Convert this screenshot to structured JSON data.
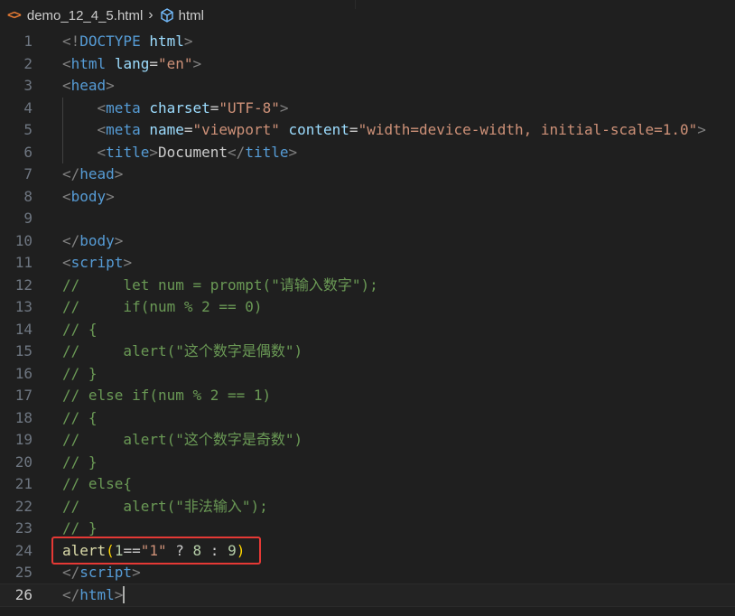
{
  "breadcrumb": {
    "file_icon": "<>",
    "file_name": "demo_12_4_5.html",
    "separator": "›",
    "element_name": "html"
  },
  "colors": {
    "background": "#1f1f1f",
    "tag": "#569cd6",
    "bracket": "#808080",
    "attribute": "#9cdcfe",
    "string": "#ce9178",
    "comment": "#6a9955",
    "function": "#dcdcaa",
    "number": "#b5cea8",
    "highlight_box": "#e53935"
  },
  "editor": {
    "current_line": 26,
    "lines": [
      {
        "n": "1",
        "tokens": [
          [
            "<!",
            "br"
          ],
          [
            "DOCTYPE",
            "tag"
          ],
          [
            " ",
            "pl"
          ],
          [
            "html",
            "attr"
          ],
          [
            ">",
            "br"
          ]
        ]
      },
      {
        "n": "2",
        "tokens": [
          [
            "<",
            "br"
          ],
          [
            "html",
            "tag"
          ],
          [
            " ",
            "pl"
          ],
          [
            "lang",
            "attr"
          ],
          [
            "=",
            "pl"
          ],
          [
            "\"en\"",
            "str"
          ],
          [
            ">",
            "br"
          ]
        ]
      },
      {
        "n": "3",
        "tokens": [
          [
            "<",
            "br"
          ],
          [
            "head",
            "tag"
          ],
          [
            ">",
            "br"
          ]
        ]
      },
      {
        "n": "4",
        "indent": true,
        "tokens": [
          [
            "    ",
            "pl"
          ],
          [
            "<",
            "br"
          ],
          [
            "meta",
            "tag"
          ],
          [
            " ",
            "pl"
          ],
          [
            "charset",
            "attr"
          ],
          [
            "=",
            "pl"
          ],
          [
            "\"UTF-8\"",
            "str"
          ],
          [
            ">",
            "br"
          ]
        ]
      },
      {
        "n": "5",
        "indent": true,
        "tokens": [
          [
            "    ",
            "pl"
          ],
          [
            "<",
            "br"
          ],
          [
            "meta",
            "tag"
          ],
          [
            " ",
            "pl"
          ],
          [
            "name",
            "attr"
          ],
          [
            "=",
            "pl"
          ],
          [
            "\"viewport\"",
            "str"
          ],
          [
            " ",
            "pl"
          ],
          [
            "content",
            "attr"
          ],
          [
            "=",
            "pl"
          ],
          [
            "\"width=device-width, initial-scale=1.0\"",
            "str"
          ],
          [
            ">",
            "br"
          ]
        ]
      },
      {
        "n": "6",
        "indent": true,
        "tokens": [
          [
            "    ",
            "pl"
          ],
          [
            "<",
            "br"
          ],
          [
            "title",
            "tag"
          ],
          [
            ">",
            "br"
          ],
          [
            "Document",
            "pl"
          ],
          [
            "</",
            "br"
          ],
          [
            "title",
            "tag"
          ],
          [
            ">",
            "br"
          ]
        ]
      },
      {
        "n": "7",
        "tokens": [
          [
            "</",
            "br"
          ],
          [
            "head",
            "tag"
          ],
          [
            ">",
            "br"
          ]
        ]
      },
      {
        "n": "8",
        "tokens": [
          [
            "<",
            "br"
          ],
          [
            "body",
            "tag"
          ],
          [
            ">",
            "br"
          ]
        ]
      },
      {
        "n": "9",
        "tokens": []
      },
      {
        "n": "10",
        "tokens": [
          [
            "</",
            "br"
          ],
          [
            "body",
            "tag"
          ],
          [
            ">",
            "br"
          ]
        ]
      },
      {
        "n": "11",
        "tokens": [
          [
            "<",
            "br"
          ],
          [
            "script",
            "tag"
          ],
          [
            ">",
            "br"
          ]
        ]
      },
      {
        "n": "12",
        "tokens": [
          [
            "//     let num = prompt(\"请输入数字\");",
            "com"
          ]
        ]
      },
      {
        "n": "13",
        "tokens": [
          [
            "//     if(num % 2 == 0)",
            "com"
          ]
        ]
      },
      {
        "n": "14",
        "tokens": [
          [
            "// {",
            "com"
          ]
        ]
      },
      {
        "n": "15",
        "tokens": [
          [
            "//     alert(\"这个数字是偶数\")",
            "com"
          ]
        ]
      },
      {
        "n": "16",
        "tokens": [
          [
            "// }",
            "com"
          ]
        ]
      },
      {
        "n": "17",
        "tokens": [
          [
            "// else if(num % 2 == 1)",
            "com"
          ]
        ]
      },
      {
        "n": "18",
        "tokens": [
          [
            "// {",
            "com"
          ]
        ]
      },
      {
        "n": "19",
        "tokens": [
          [
            "//     alert(\"这个数字是奇数\")",
            "com"
          ]
        ]
      },
      {
        "n": "20",
        "tokens": [
          [
            "// }",
            "com"
          ]
        ]
      },
      {
        "n": "21",
        "tokens": [
          [
            "// else{",
            "com"
          ]
        ]
      },
      {
        "n": "22",
        "tokens": [
          [
            "//     alert(\"非法输入\");",
            "com"
          ]
        ]
      },
      {
        "n": "23",
        "tokens": [
          [
            "// }",
            "com"
          ]
        ]
      },
      {
        "n": "24",
        "tokens": [
          [
            "alert",
            "fn"
          ],
          [
            "(",
            "paren"
          ],
          [
            "1",
            "num"
          ],
          [
            "==",
            "pl"
          ],
          [
            "\"1\"",
            "str"
          ],
          [
            " ? ",
            "pl"
          ],
          [
            "8",
            "num"
          ],
          [
            " : ",
            "pl"
          ],
          [
            "9",
            "num"
          ],
          [
            ")",
            "paren"
          ]
        ]
      },
      {
        "n": "25",
        "tokens": [
          [
            "</",
            "br"
          ],
          [
            "script",
            "tag"
          ],
          [
            ">",
            "br"
          ]
        ]
      },
      {
        "n": "26",
        "cursor": true,
        "tokens": [
          [
            "</",
            "br"
          ],
          [
            "html",
            "tag"
          ],
          [
            ">",
            "br"
          ]
        ]
      }
    ]
  }
}
